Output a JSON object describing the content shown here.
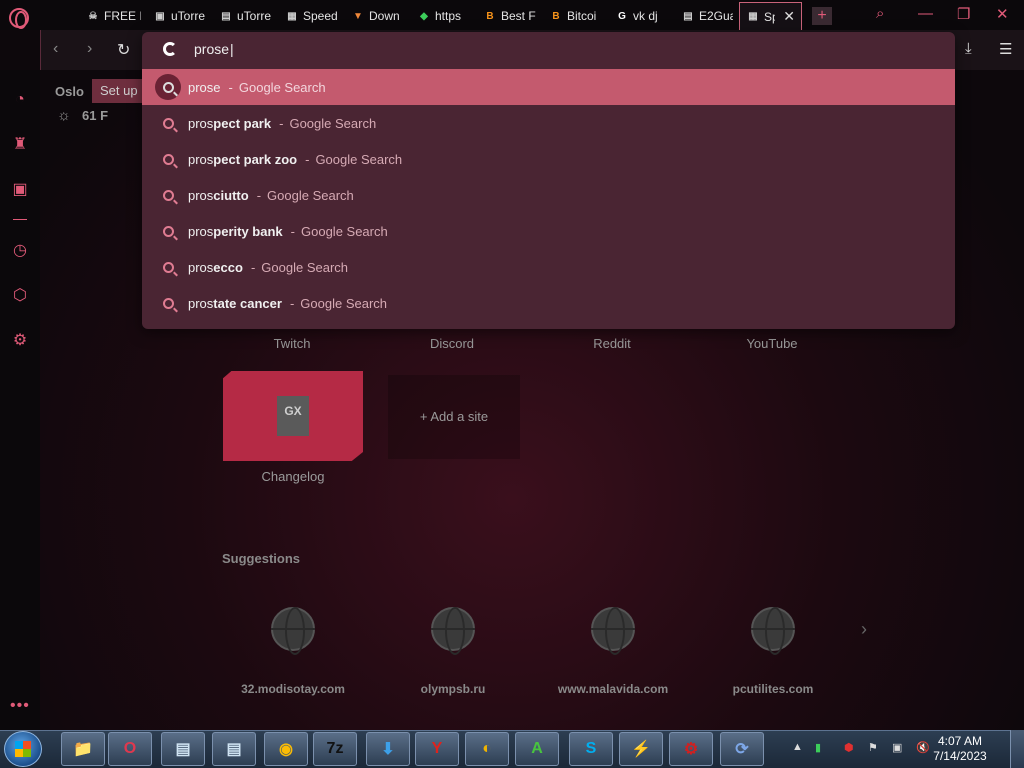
{
  "tabs": [
    {
      "title": "FREE I",
      "icon": "skull-icon",
      "fav": "☠",
      "favColor": "#cccccc"
    },
    {
      "title": "uTorre",
      "icon": "utorrent-page-icon",
      "fav": "▣",
      "favColor": "#cccccc"
    },
    {
      "title": "uTorre",
      "icon": "document-icon",
      "fav": "▤",
      "favColor": "#cccccc"
    },
    {
      "title": "Speed",
      "icon": "grid-icon",
      "fav": "▦",
      "favColor": "#cccccc"
    },
    {
      "title": "Down",
      "icon": "fox-icon",
      "fav": "▼",
      "favColor": "#f0883a"
    },
    {
      "title": "https",
      "icon": "shield-icon",
      "fav": "◆",
      "favColor": "#3ccd5a"
    },
    {
      "title": "Best F",
      "icon": "bitcoin-icon",
      "fav": "B",
      "favColor": "#f7931a"
    },
    {
      "title": "Bitcoi",
      "icon": "bitcoin-icon",
      "fav": "B",
      "favColor": "#f7931a"
    },
    {
      "title": "vk dj",
      "icon": "google-icon",
      "fav": "G",
      "favColor": "#ffffff"
    },
    {
      "title": "E2Gua",
      "icon": "document-icon",
      "fav": "▤",
      "favColor": "#cccccc"
    },
    {
      "title": "Sp",
      "icon": "grid-icon",
      "fav": "▦",
      "favColor": "#cccccc",
      "active": true
    }
  ],
  "address_bar": {
    "value": "prose"
  },
  "suggestions": [
    {
      "prefix": "pros",
      "rest": "e",
      "bold_rest": false,
      "source": "Google Search"
    },
    {
      "prefix": "pros",
      "rest": "pect park",
      "bold_rest": true,
      "source": "Google Search"
    },
    {
      "prefix": "pros",
      "rest": "pect park zoo",
      "bold_rest": true,
      "source": "Google Search"
    },
    {
      "prefix": "pros",
      "rest": "ciutto",
      "bold_rest": true,
      "source": "Google Search"
    },
    {
      "prefix": "pros",
      "rest": "perity bank",
      "bold_rest": true,
      "source": "Google Search"
    },
    {
      "prefix": "pros",
      "rest": "ecco",
      "bold_rest": true,
      "source": "Google Search"
    },
    {
      "prefix": "pros",
      "rest": "tate cancer",
      "bold_rest": true,
      "source": "Google Search"
    }
  ],
  "suggestion_separator": "-",
  "weather": {
    "city": "Oslo",
    "setup_label": "Set up",
    "temperature": "61 F"
  },
  "speed_dial": {
    "labels": [
      "Twitch",
      "Discord",
      "Reddit",
      "YouTube"
    ],
    "changelog_label": "Changelog",
    "gx_badge": "GX",
    "add_site_label": "+ Add a site"
  },
  "suggestions_section": {
    "title": "Suggestions",
    "sites": [
      "32.modisotay.com",
      "olympsb.ru",
      "www.malavida.com",
      "pcutilites.com"
    ]
  },
  "taskbar": {
    "apps": [
      {
        "name": "file-explorer-icon",
        "glyph": "📁",
        "color": "#f2c94c"
      },
      {
        "name": "opera-icon",
        "glyph": "O",
        "color": "#e0384e"
      },
      {
        "name": "document-viewer-icon",
        "glyph": "▤",
        "color": "#cfe3f2"
      },
      {
        "name": "document-viewer-icon-2",
        "glyph": "▤",
        "color": "#cfe3f2"
      },
      {
        "name": "chrome-icon",
        "glyph": "◉",
        "color": "#fbbc05"
      },
      {
        "name": "7zip-icon",
        "glyph": "7z",
        "color": "#111111"
      },
      {
        "name": "download-manager-icon",
        "glyph": "⬇",
        "color": "#3da0e8"
      },
      {
        "name": "yandex-icon",
        "glyph": "Y",
        "color": "#e0221c"
      },
      {
        "name": "browser-icon",
        "glyph": "◐",
        "color": "#f0b400"
      },
      {
        "name": "android-app-icon",
        "glyph": "A",
        "color": "#48c43e"
      },
      {
        "name": "skype-icon",
        "glyph": "S",
        "color": "#00aff0"
      },
      {
        "name": "bolt-app-icon",
        "glyph": "⚡",
        "color": "#2f8ff0"
      },
      {
        "name": "security-app-icon",
        "glyph": "⚙",
        "color": "#d02020"
      },
      {
        "name": "sync-app-icon",
        "glyph": "⟳",
        "color": "#7da7e8"
      }
    ],
    "clock_time": "4:07 AM",
    "clock_date": "7/14/2023"
  }
}
